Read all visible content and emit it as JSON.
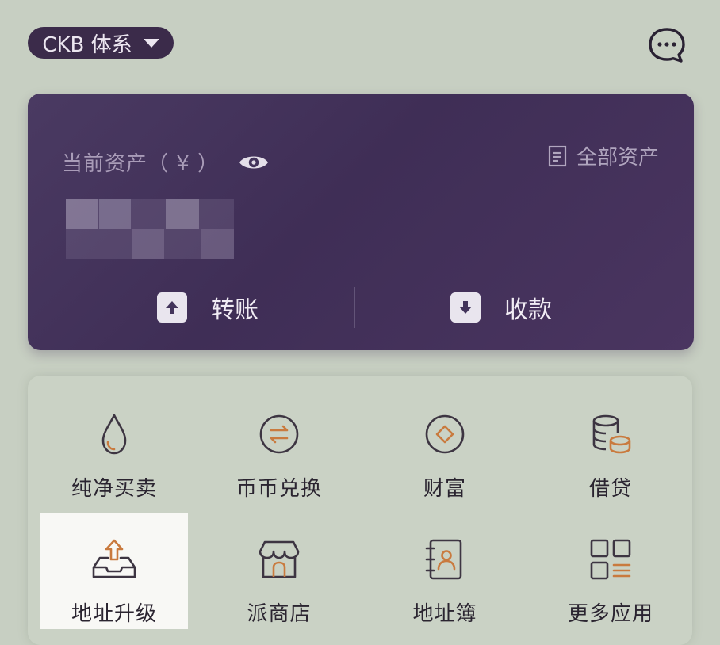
{
  "header": {
    "chain_selector": "CKB 体系",
    "chat_icon": "chat-bubble-icon"
  },
  "asset_card": {
    "current_assets_label": "当前资产（ ¥ ）",
    "all_assets_label": "全部资产",
    "transfer_label": "转账",
    "receive_label": "收款",
    "colors": {
      "card_bg": "#43345b",
      "accent": "#d07a3a"
    }
  },
  "features": {
    "items": [
      {
        "label": "纯净买卖",
        "icon": "drop-icon"
      },
      {
        "label": "币币兑换",
        "icon": "swap-icon"
      },
      {
        "label": "财富",
        "icon": "diamond-icon"
      },
      {
        "label": "借贷",
        "icon": "coins-icon"
      },
      {
        "label": "地址升级",
        "icon": "upload-tray-icon"
      },
      {
        "label": "派商店",
        "icon": "store-icon"
      },
      {
        "label": "地址簿",
        "icon": "address-book-icon"
      },
      {
        "label": "更多应用",
        "icon": "more-apps-icon"
      }
    ]
  }
}
